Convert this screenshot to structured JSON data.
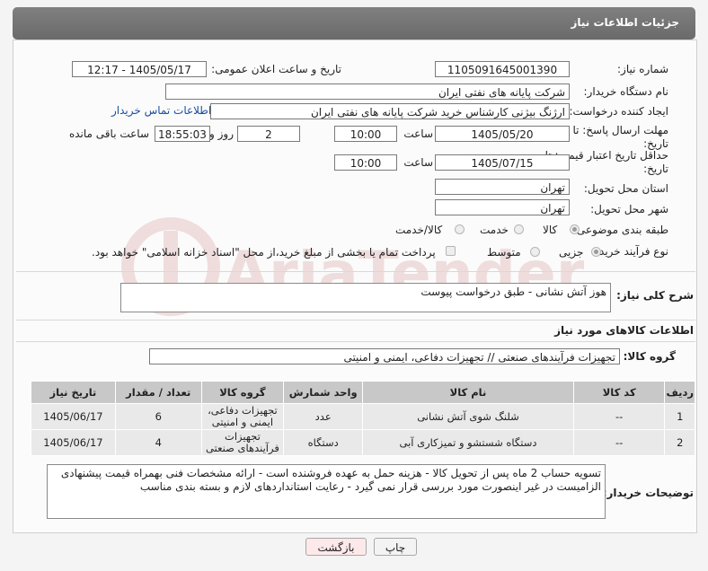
{
  "header": {
    "title": "جزئیات اطلاعات نیاز"
  },
  "fields": {
    "need_number_label": "شماره نیاز:",
    "need_number": "1105091645001390",
    "announce_label": "تاریخ و ساعت اعلان عمومی:",
    "announce_value": "1405/05/17 - 12:17",
    "buyer_org_label": "نام دستگاه خریدار:",
    "buyer_org": "شرکت پایانه های نفتی ایران",
    "requester_label": "ایجاد کننده درخواست:",
    "requester": "ارژنگ بیژنی کارشناس خرید شرکت پایانه های نفتی ایران",
    "contact_link": "اطلاعات تماس خریدار",
    "deadline_label": "مهلت ارسال پاسخ: تا تاریخ:",
    "deadline_date": "1405/05/20",
    "time_label": "ساعت",
    "deadline_time": "10:00",
    "days_value": "2",
    "days_label": "روز و",
    "remaining_time": "18:55:03",
    "remaining_label": "ساعت باقی مانده",
    "price_validity_label": "حداقل تاریخ اعتبار قیمت: تا تاریخ:",
    "price_date": "1405/07/15",
    "price_time": "10:00",
    "province_label": "استان محل تحویل:",
    "province": "تهران",
    "city_label": "شهر محل تحویل:",
    "city": "تهران",
    "category_label": "طبقه بندی موضوعی:",
    "category_options": [
      "کالا",
      "خدمت",
      "کالا/خدمت"
    ],
    "process_label": "نوع فرآیند خرید :",
    "process_options": [
      "جزیی",
      "متوسط"
    ],
    "payment_note": "پرداخت تمام یا بخشی از مبلغ خرید،از محل \"اسناد خزانه اسلامی\" خواهد بود."
  },
  "description": {
    "label": "شرح کلی نیاز:",
    "value": "هوز آتش نشانی - طبق درخواست پیوست"
  },
  "goods_section": {
    "title": "اطلاعات کالاهای مورد نیاز",
    "group_label": "گروه کالا:",
    "group_value": "تجهیزات فرآیندهای صنعتی // تجهیزات دفاعی، ایمنی و امنیتی"
  },
  "table": {
    "headers": [
      "ردیف",
      "کد کالا",
      "نام کالا",
      "واحد شمارش",
      "گروه کالا",
      "تعداد / مقدار",
      "تاریخ نیاز"
    ],
    "rows": [
      [
        "1",
        "--",
        "شلنگ شوی آتش نشانی",
        "عدد",
        "تجهیزات دفاعی، ایمنی و امنیتی",
        "6",
        "1405/06/17"
      ],
      [
        "2",
        "--",
        "دستگاه شستشو و تمیزکاری آبی",
        "دستگاه",
        "تجهیزات فرآیندهای صنعتی",
        "4",
        "1405/06/17"
      ]
    ]
  },
  "buyer_notes": {
    "label": "توضیحات خریدار:",
    "value": "تسویه حساب 2 ماه پس از تحویل کالا - هزینه حمل به عهده فروشنده است - ارائه مشخصات فنی بهمراه قیمت پیشنهادی الزامیست در غیر اینصورت مورد بررسی قرار نمی گیرد - رعایت استانداردهای لازم و بسته بندی مناسب"
  },
  "buttons": {
    "print": "چاپ",
    "back": "بازگشت"
  },
  "watermark": {
    "text": "AriaTender.net"
  },
  "colors": {
    "header_bg": "#757575",
    "link": "#1a4fa0",
    "back_btn_bg": "#fde8ea",
    "watermark": "#e9c9c9"
  }
}
